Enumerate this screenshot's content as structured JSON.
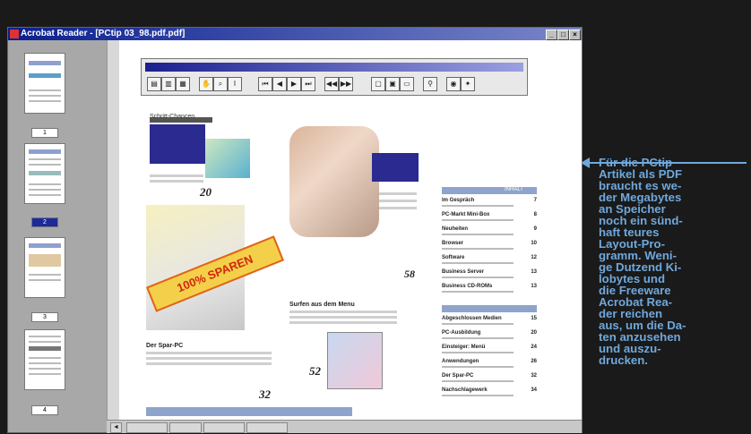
{
  "window": {
    "title": "Acrobat Reader - [PCtip 03_98.pdf.pdf]"
  },
  "thumbnails": [
    {
      "label": "1"
    },
    {
      "label": "2",
      "selected": true
    },
    {
      "label": "3"
    },
    {
      "label": "4"
    }
  ],
  "article": {
    "heading_left": "Schritt-Chancen",
    "page_num_1": "20",
    "page_num_2": "58",
    "page_num_3": "52",
    "page_num_4": "32",
    "stamp": "100% SPAREN",
    "subhead_mid": "Surfen aus dem Menu",
    "subhead_left": "Der Spar-PC",
    "toc_header": "INHALT",
    "toc_rows": [
      {
        "title": "Im Gespräch",
        "page": "7"
      },
      {
        "title": "PC-Markt Mini-Box",
        "page": "8"
      },
      {
        "title": "Neuheiten",
        "page": "9"
      },
      {
        "title": "Browser",
        "page": "10"
      },
      {
        "title": "Software",
        "page": "12"
      },
      {
        "title": "Business Server",
        "page": "13"
      },
      {
        "title": "Business CD-ROMs",
        "page": "13"
      }
    ],
    "toc_rows_2": [
      {
        "title": "Abgeschlossen Medien",
        "page": "15"
      },
      {
        "title": "PC-Ausbildung",
        "page": "20"
      },
      {
        "title": "Einsteiger: Menü",
        "page": "24"
      },
      {
        "title": "Anwendungen",
        "page": "26"
      },
      {
        "title": "Der Spar-PC",
        "page": "32"
      },
      {
        "title": "Nachschlagewerk",
        "page": "34"
      }
    ]
  },
  "caption": "Für die PCtip Artikel als PDF braucht es weder Megabytes an Speicher noch ein sündhaft teures Layout-Programm. Wenige Dutzend Kilobytes und die Freeware Acrobat Reader reichen aus, um die Daten anzusehen und auszudrucken.",
  "caption_lines": [
    "Für die PCtip",
    "Artikel als PDF",
    "braucht es we-",
    "der Megabytes",
    "an Speicher",
    "noch ein sünd-",
    "haft teures",
    "Layout-Pro-",
    "gramm. Weni-",
    "ge Dutzend Ki-",
    "lobytes und",
    "die Freeware",
    "Acrobat Rea-",
    "der reichen",
    "aus, um die Da-",
    "ten anzusehen",
    "und auszu-",
    "drucken."
  ]
}
